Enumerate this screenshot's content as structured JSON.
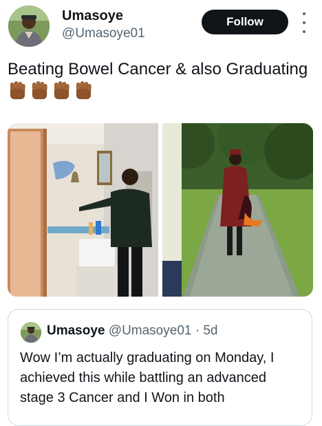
{
  "author": {
    "name": "Umasoye",
    "handle": "@Umasoye01"
  },
  "follow_label": "Follow",
  "tweet": {
    "text": "Beating Bowel Cancer & also Graduating",
    "emoji": "raised-fist-medium-dark-skin-tone x4"
  },
  "media": [
    {
      "description": "hospital-bell-photo"
    },
    {
      "description": "graduation-walk-photo"
    }
  ],
  "quoted": {
    "name": "Umasoye",
    "handle": "@Umasoye01",
    "separator": "·",
    "time": "5d",
    "text": "Wow I’m actually graduating on Monday, I achieved this while battling an advanced stage 3 Cancer and I Won in both"
  },
  "colors": {
    "follow_bg": "#0f1419",
    "secondary_text": "#536471",
    "border": "#cfd9de",
    "fist": "#9a5b2e"
  }
}
